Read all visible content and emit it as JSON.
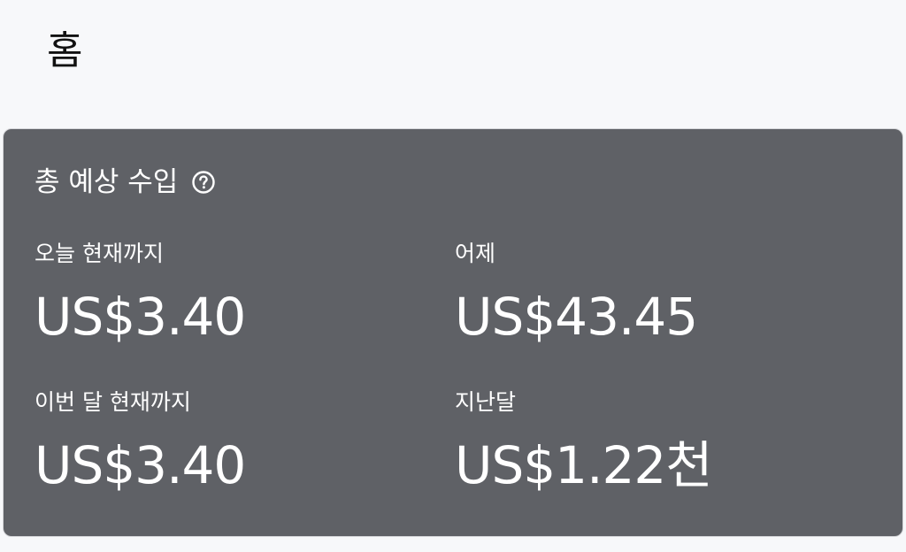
{
  "header": {
    "title": "홈"
  },
  "earnings_card": {
    "title": "총 예상 수입",
    "help_icon": "help-circle-icon",
    "metrics": [
      {
        "label": "오늘 현재까지",
        "value": "US$3.40"
      },
      {
        "label": "어제",
        "value": "US$43.45"
      },
      {
        "label": "이번 달 현재까지",
        "value": "US$3.40"
      },
      {
        "label": "지난달",
        "value": "US$1.22천"
      }
    ]
  },
  "colors": {
    "page_background": "#f7f8fa",
    "card_background": "#5f6166",
    "text_on_card": "#ffffff",
    "title_text": "#111111"
  }
}
